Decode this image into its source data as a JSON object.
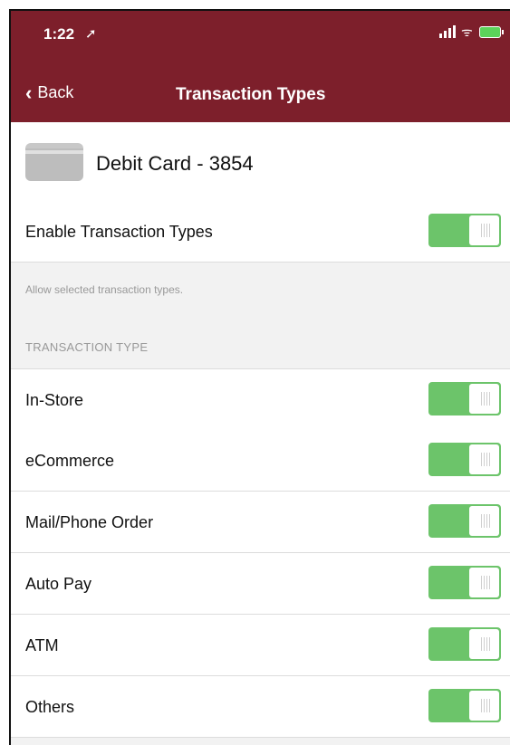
{
  "status_bar": {
    "time": "1:22",
    "location_icon": "location-arrow-icon",
    "signal_icon": "cellular-signal-icon",
    "wifi_icon": "wifi-icon",
    "battery_icon": "battery-charging-icon",
    "battery_color": "#5cd35a"
  },
  "navbar": {
    "back_label": "Back",
    "back_icon": "chevron-left-icon",
    "title": "Transaction Types",
    "background": "#7d1f2b"
  },
  "card": {
    "name": "Debit Card - 3854",
    "icon": "credit-card-icon"
  },
  "enable": {
    "label": "Enable Transaction Types",
    "enabled": true,
    "note": "Allow selected transaction types."
  },
  "section": {
    "header": "TRANSACTION TYPE"
  },
  "transaction_types": [
    {
      "label": "In-Store",
      "enabled": true
    },
    {
      "label": "eCommerce",
      "enabled": true
    },
    {
      "label": "Mail/Phone Order",
      "enabled": true
    },
    {
      "label": "Auto Pay",
      "enabled": true
    },
    {
      "label": "ATM",
      "enabled": true
    },
    {
      "label": "Others",
      "enabled": true
    }
  ],
  "toggle_on_color": "#6cc46a"
}
